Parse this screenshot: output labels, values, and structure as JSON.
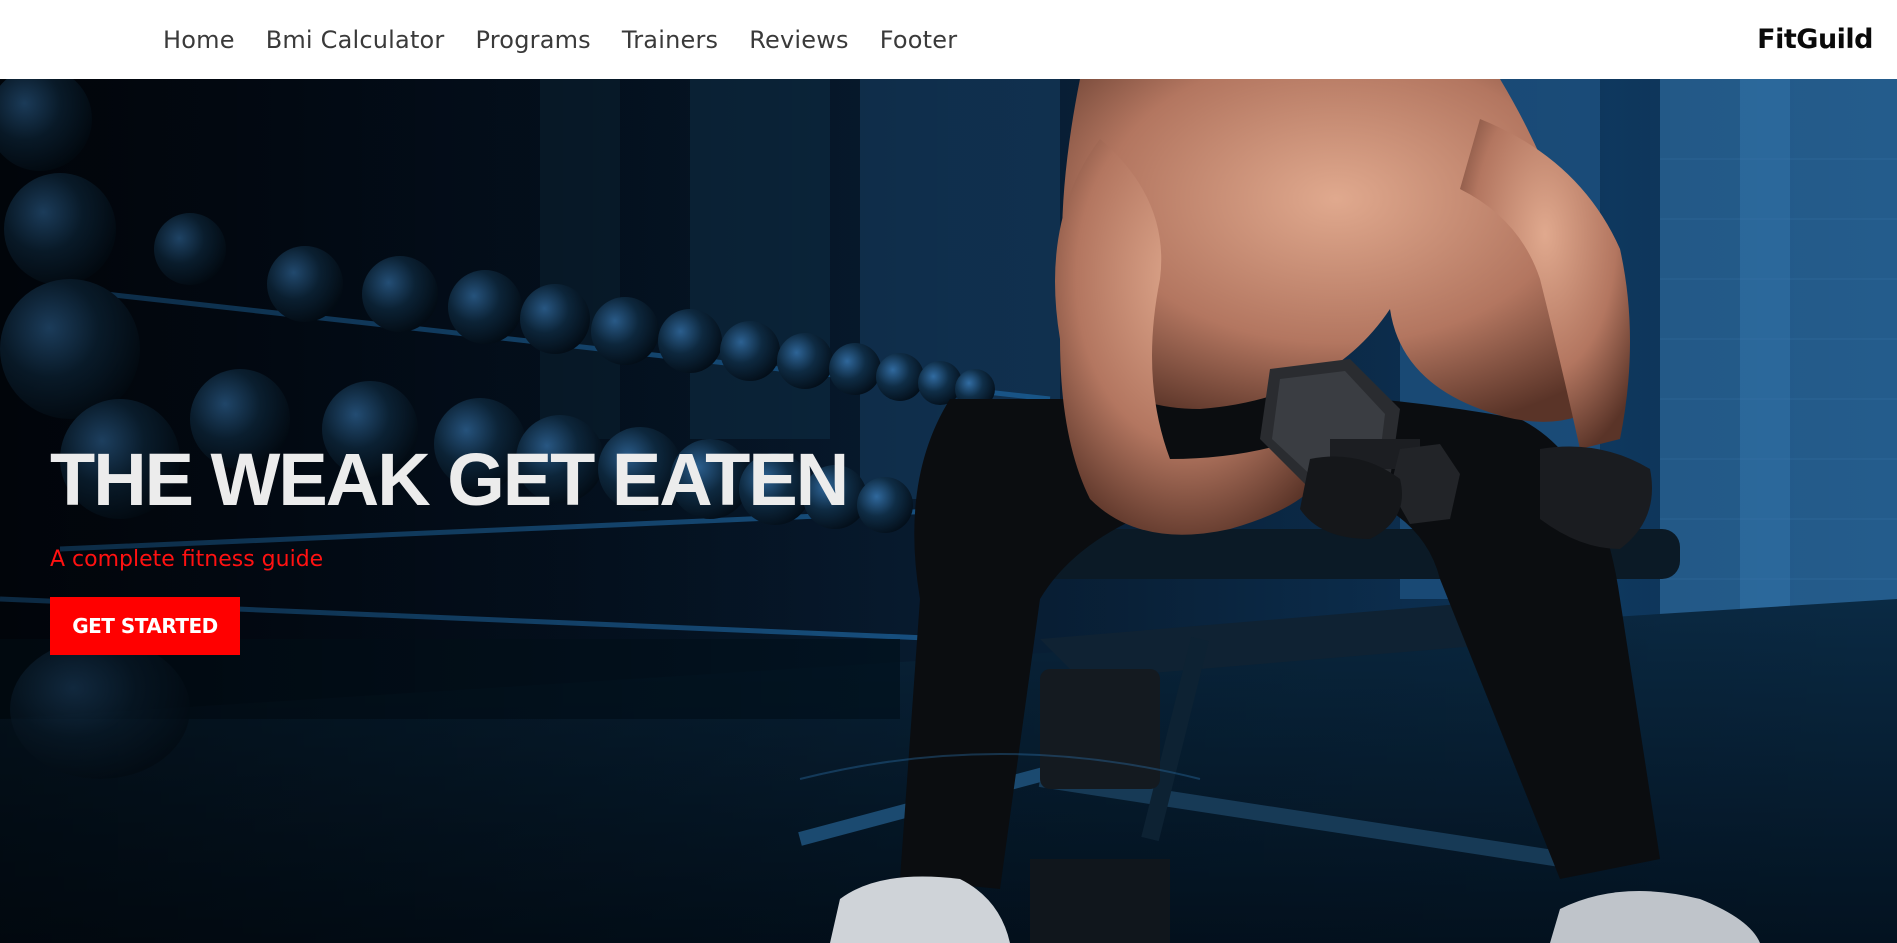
{
  "nav": {
    "links": [
      "Home",
      "Bmi Calculator",
      "Programs",
      "Trainers",
      "Reviews",
      "Footer"
    ],
    "brand": "FitGuild"
  },
  "hero": {
    "title": "THE WEAK GET EATEN",
    "subtitle": "A complete fitness guide",
    "cta_label": "GET STARTED",
    "image_subject": "man-curling-dumbbell-in-dark-blue-gym"
  },
  "colors": {
    "accent": "#ff0000",
    "nav_bg": "#ffffff",
    "nav_text": "#3a3a3a",
    "hero_title": "#ececec",
    "hero_bg": "#04101c"
  }
}
